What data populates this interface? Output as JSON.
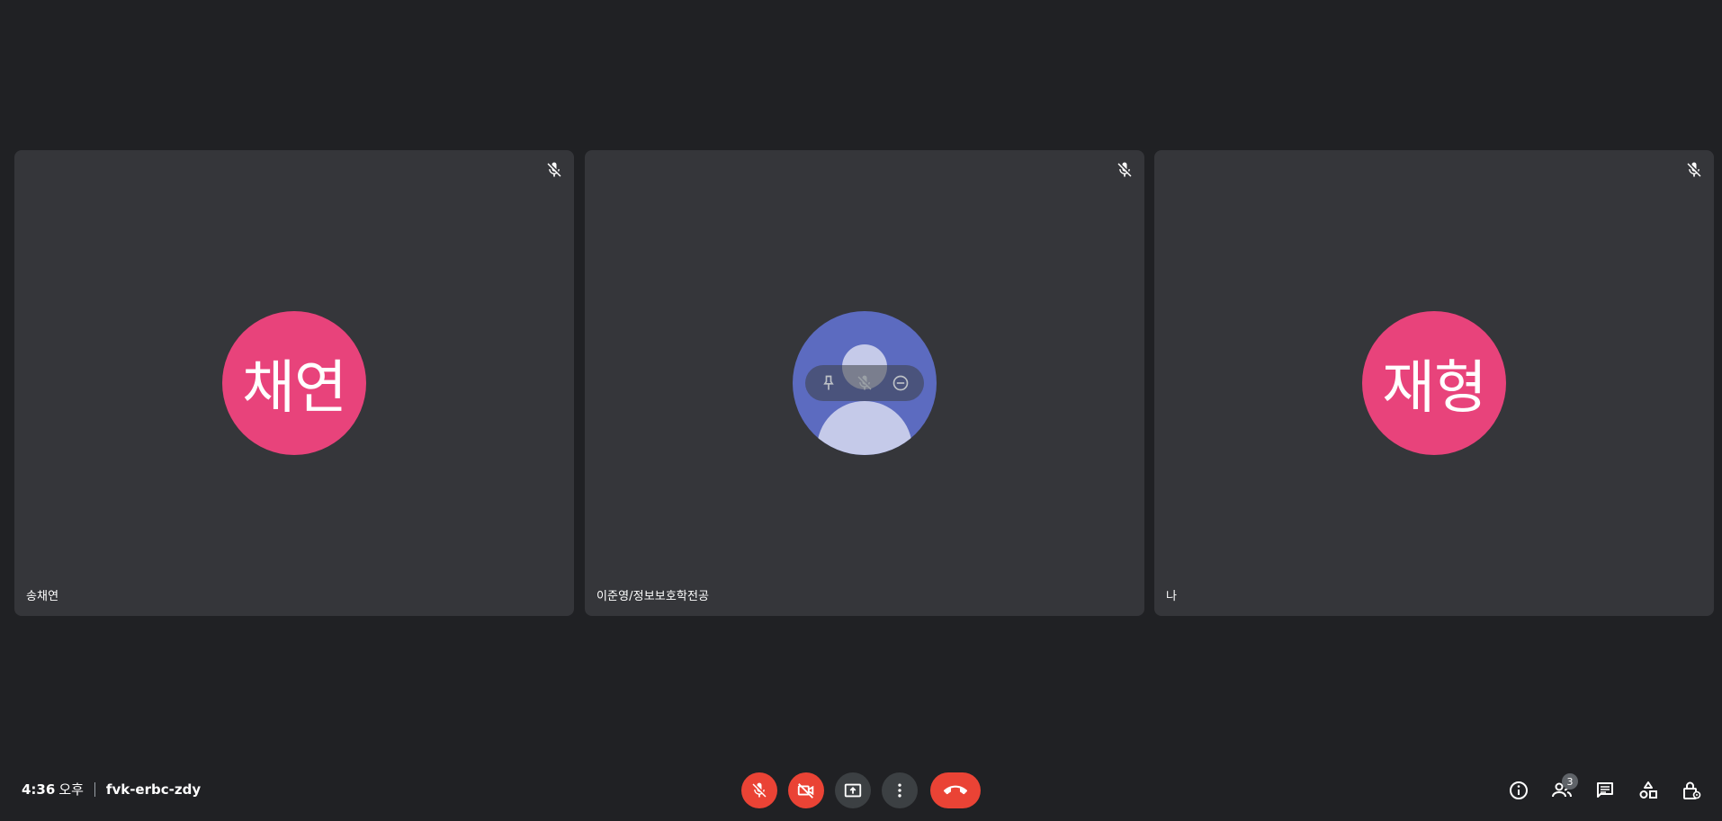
{
  "participants": [
    {
      "name": "송채연",
      "initials": "채연",
      "avatar_color": "#e8437b",
      "muted": true
    },
    {
      "name": "이준영/정보보호학전공",
      "avatar": "default-profile",
      "avatar_color": "#5c6bc0",
      "muted": true
    },
    {
      "name": "나",
      "initials": "재형",
      "avatar_color": "#e8437b",
      "muted": true
    }
  ],
  "hover_actions": [
    "pin-icon",
    "mic-off-icon",
    "remove-icon"
  ],
  "meeting": {
    "time": "4:36",
    "time_suffix": "오후",
    "code": "fvk-erbc-zdy"
  },
  "controls": [
    "mic-off-icon",
    "camera-off-icon",
    "present-screen-icon",
    "more-options-icon",
    "leave-call-icon"
  ],
  "right_icons": {
    "info": "info-icon",
    "people": "people-icon",
    "people_count": "3",
    "chat": "chat-icon",
    "activities": "activities-icon",
    "host_controls": "host-controls-icon"
  },
  "colors": {
    "background": "#202124",
    "tile": "#35363a",
    "danger": "#ea4335",
    "control": "#3c4043"
  }
}
